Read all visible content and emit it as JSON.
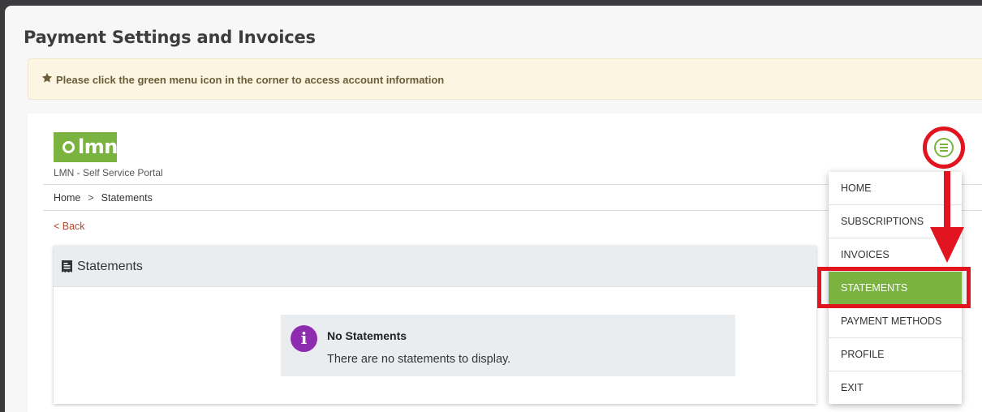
{
  "page": {
    "title": "Payment Settings and Invoices"
  },
  "notice": {
    "icon": "star-icon",
    "text": "Please click the green menu icon in the corner to access account information"
  },
  "portal": {
    "logo_text": "lmn",
    "name": "LMN - Self Service Portal",
    "breadcrumb": [
      "Home",
      ">",
      "Statements"
    ],
    "back_label": "< Back"
  },
  "card": {
    "icon": "receipt-icon",
    "title": "Statements",
    "empty": {
      "icon": "info-icon",
      "icon_glyph": "i",
      "title": "No Statements",
      "description": "There are no statements to display."
    }
  },
  "menu": {
    "button_icon": "hamburger-menu-icon",
    "items": [
      {
        "label": "HOME",
        "active": false
      },
      {
        "label": "SUBSCRIPTIONS",
        "active": false
      },
      {
        "label": "INVOICES",
        "active": false
      },
      {
        "label": "STATEMENTS",
        "active": true
      },
      {
        "label": "PAYMENT METHODS",
        "active": false
      },
      {
        "label": "PROFILE",
        "active": false
      },
      {
        "label": "EXIT",
        "active": false
      }
    ]
  },
  "colors": {
    "brand_green": "#7ab33f",
    "annotation_red": "#e2141f",
    "info_purple": "#8e2cb0",
    "back_link": "#b4452d"
  }
}
